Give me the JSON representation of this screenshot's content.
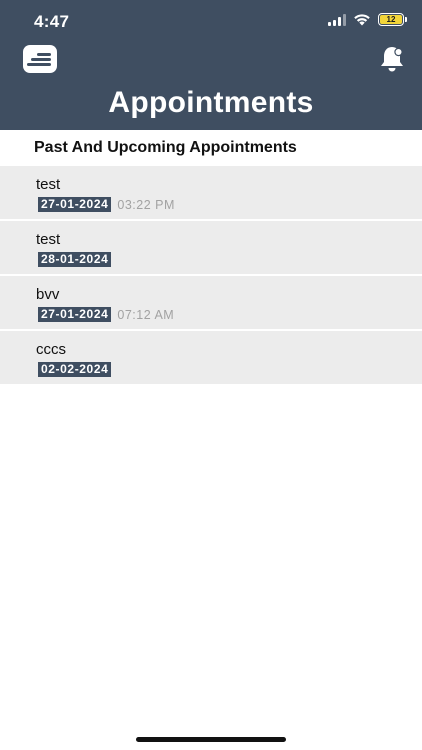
{
  "status_bar": {
    "time": "4:47",
    "battery": "12",
    "signal_icon": "cellular-signal-icon",
    "wifi_icon": "wifi-icon",
    "battery_color": "#f2d53a"
  },
  "header": {
    "title": "Appointments",
    "menu_icon": "menu-icon",
    "bell_icon": "bell-icon",
    "background": "#3f4e61"
  },
  "section": {
    "title": "Past And Upcoming Appointments"
  },
  "appointments": [
    {
      "title": "test",
      "date": "27-01-2024",
      "time": "03:22 PM"
    },
    {
      "title": "test",
      "date": "28-01-2024",
      "time": ""
    },
    {
      "title": "bvv",
      "date": "27-01-2024",
      "time": "07:12 AM"
    },
    {
      "title": "cccs",
      "date": "02-02-2024",
      "time": ""
    }
  ]
}
